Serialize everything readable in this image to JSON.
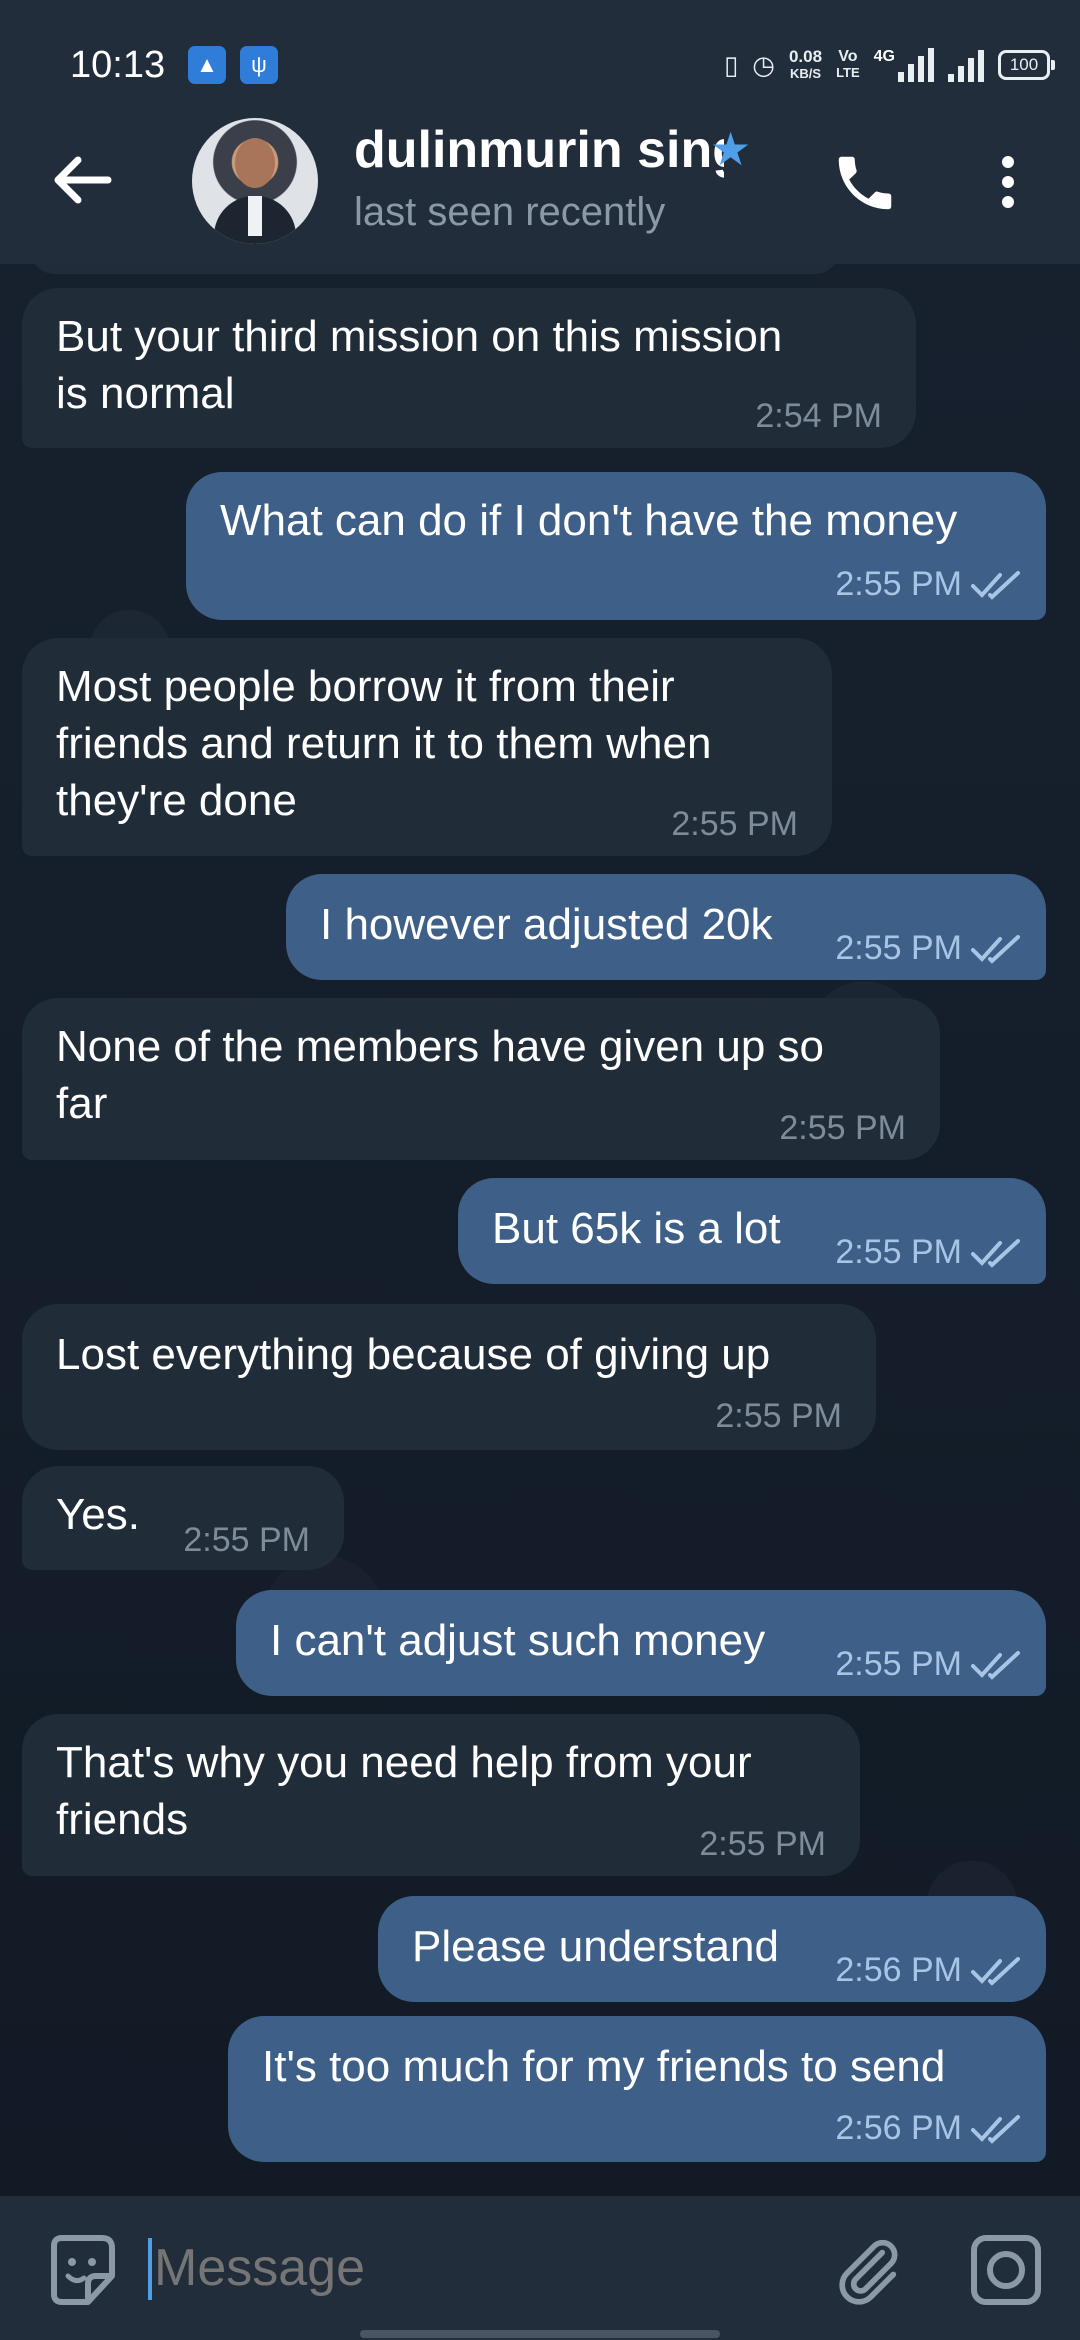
{
  "status_bar": {
    "time": "10:13",
    "net_speed_value": "0.08",
    "net_speed_unit": "KB/S",
    "volte_line1": "Vo",
    "volte_line2": "LTE",
    "network_type": "4G",
    "battery": "100"
  },
  "header": {
    "contact_name": "dulinmurin sing",
    "status": "last seen recently",
    "avatar_icon": "avatar-photo",
    "star_icon": "star-icon",
    "accent_color": "#4f9fe8"
  },
  "messages": [
    {
      "dir": "in",
      "text": "But your third mission on this mission\nis normal",
      "time": "2:54 PM"
    },
    {
      "dir": "out",
      "text": "What can do if I don't have the money",
      "time": "2:55 PM",
      "read": true
    },
    {
      "dir": "in",
      "text": "Most people borrow it from their\nfriends and return it to them when\nthey're done",
      "time": "2:55 PM"
    },
    {
      "dir": "out",
      "text": "I however adjusted 20k",
      "time": "2:55 PM",
      "read": true
    },
    {
      "dir": "in",
      "text": "None of the members have given up so\nfar",
      "time": "2:55 PM"
    },
    {
      "dir": "out",
      "text": "But 65k is a lot",
      "time": "2:55 PM",
      "read": true
    },
    {
      "dir": "in",
      "text": "Lost everything because of giving up",
      "time": "2:55 PM"
    },
    {
      "dir": "in",
      "text": "Yes.",
      "time": "2:55 PM"
    },
    {
      "dir": "out",
      "text": "I can't adjust such money",
      "time": "2:55 PM",
      "read": true
    },
    {
      "dir": "in",
      "text": "That's why you need help from your\nfriends",
      "time": "2:55 PM"
    },
    {
      "dir": "out",
      "text": "Please understand",
      "time": "2:56 PM",
      "read": true
    },
    {
      "dir": "out",
      "text": "It's too much for my friends to send",
      "time": "2:56 PM",
      "read": true
    }
  ],
  "composer": {
    "placeholder": "Message"
  },
  "colors": {
    "incoming_bubble": "#212c39",
    "outgoing_bubble": "#3e5f88",
    "header_bg": "#212d3b"
  }
}
